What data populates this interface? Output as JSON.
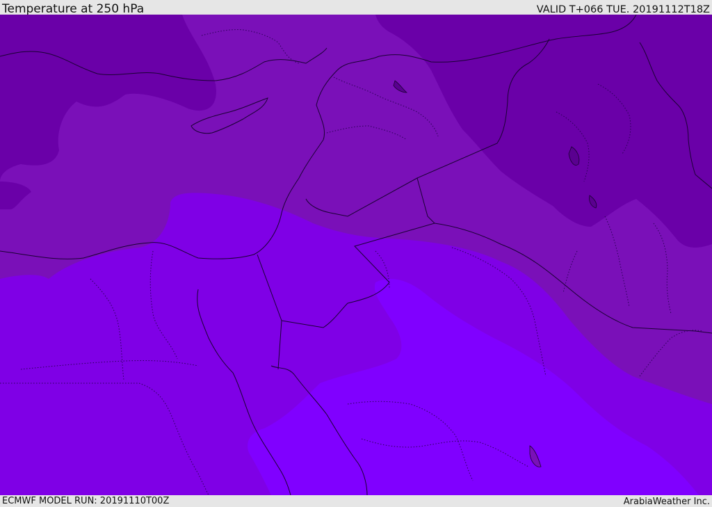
{
  "header": {
    "title": "Temperature at 250 hPa",
    "valid_time": "VALID T+066 TUE. 20191112T18Z"
  },
  "footer": {
    "model_run": "ECMWF MODEL RUN: 20191110T00Z",
    "provider": "ArabiaWeather Inc."
  },
  "colors": {
    "band_coldest": "#6a00a8",
    "band_cold": "#7a10b8",
    "band_mid": "#7f00e6",
    "band_warm": "#8000ff",
    "border": "#1a0033"
  }
}
